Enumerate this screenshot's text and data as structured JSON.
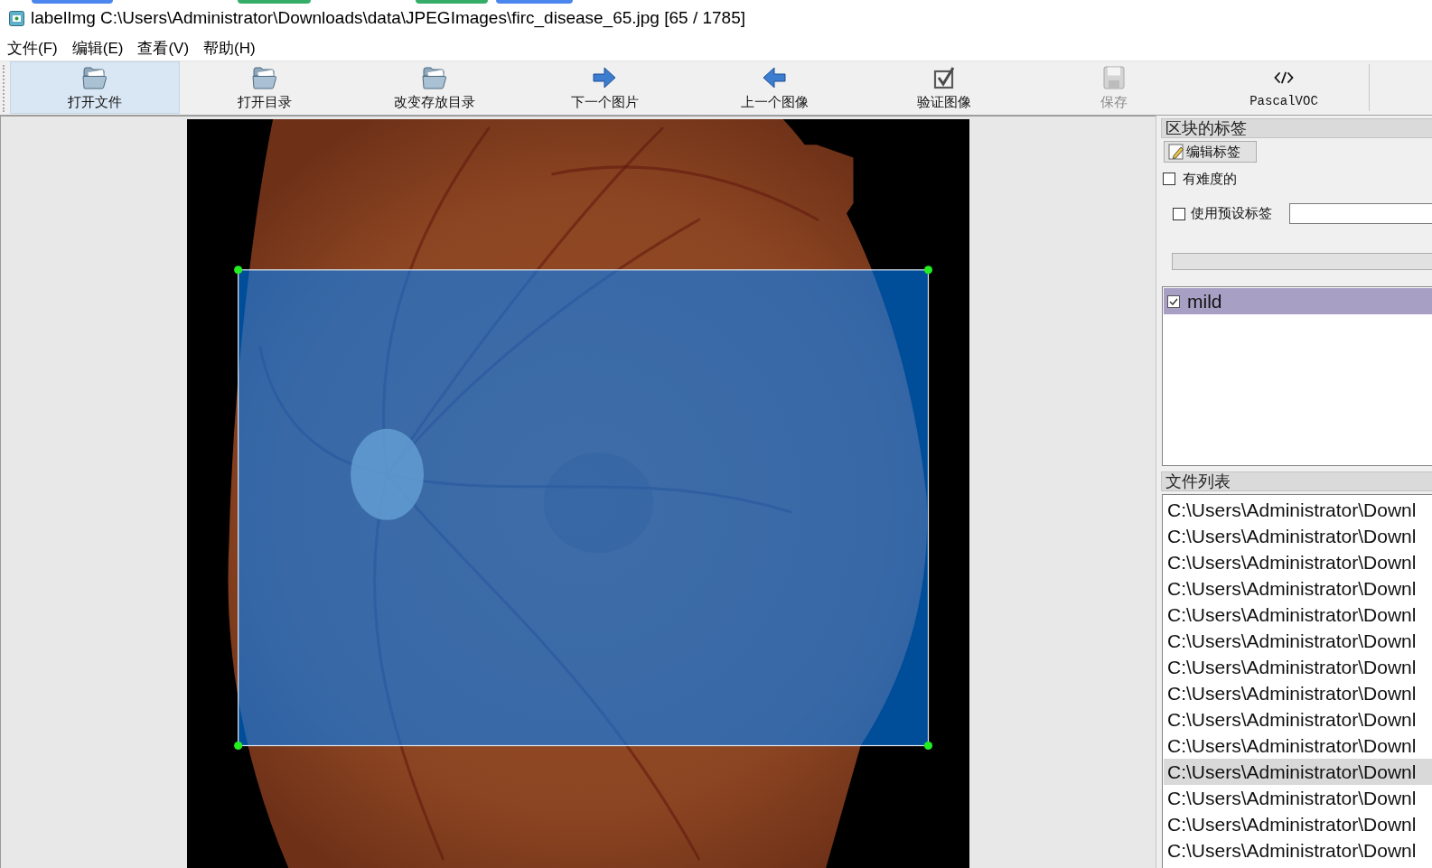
{
  "window": {
    "title": "labelImg C:\\Users\\Administrator\\Downloads\\data\\JPEGImages\\firc_disease_65.jpg [65 / 1785]"
  },
  "menu": [
    "文件(F)",
    "编辑(E)",
    "查看(V)",
    "帮助(H)"
  ],
  "toolbar": [
    {
      "label": "打开文件",
      "kind": "folder",
      "highlighted": true,
      "disabled": false
    },
    {
      "label": "打开目录",
      "kind": "folder",
      "highlighted": false,
      "disabled": false
    },
    {
      "label": "改变存放目录",
      "kind": "folder",
      "highlighted": false,
      "disabled": false
    },
    {
      "label": "下一个图片",
      "kind": "next",
      "highlighted": false,
      "disabled": false
    },
    {
      "label": "上一个图像",
      "kind": "prev",
      "highlighted": false,
      "disabled": false
    },
    {
      "label": "验证图像",
      "kind": "verify",
      "highlighted": false,
      "disabled": false
    },
    {
      "label": "保存",
      "kind": "save",
      "highlighted": false,
      "disabled": true
    },
    {
      "label": "PascalVOC",
      "kind": "format",
      "highlighted": false,
      "disabled": false
    }
  ],
  "label_panel": {
    "title": "区块的标签",
    "edit_button": "编辑标签",
    "difficult": {
      "label": "有难度的",
      "checked": false
    },
    "default_label": {
      "label": "使用预设标签",
      "checked": false
    },
    "labels": [
      {
        "name": "mild",
        "checked": true,
        "selected": true
      }
    ]
  },
  "file_panel": {
    "title": "文件列表",
    "files": [
      {
        "path": "C:\\Users\\Administrator\\Downl",
        "selected": false
      },
      {
        "path": "C:\\Users\\Administrator\\Downl",
        "selected": false
      },
      {
        "path": "C:\\Users\\Administrator\\Downl",
        "selected": false
      },
      {
        "path": "C:\\Users\\Administrator\\Downl",
        "selected": false
      },
      {
        "path": "C:\\Users\\Administrator\\Downl",
        "selected": false
      },
      {
        "path": "C:\\Users\\Administrator\\Downl",
        "selected": false
      },
      {
        "path": "C:\\Users\\Administrator\\Downl",
        "selected": false
      },
      {
        "path": "C:\\Users\\Administrator\\Downl",
        "selected": false
      },
      {
        "path": "C:\\Users\\Administrator\\Downl",
        "selected": false
      },
      {
        "path": "C:\\Users\\Administrator\\Downl",
        "selected": false
      },
      {
        "path": "C:\\Users\\Administrator\\Downl",
        "selected": true
      },
      {
        "path": "C:\\Users\\Administrator\\Downl",
        "selected": false
      },
      {
        "path": "C:\\Users\\Administrator\\Downl",
        "selected": false
      },
      {
        "path": "C:\\Users\\Administrator\\Downl",
        "selected": false
      }
    ]
  }
}
